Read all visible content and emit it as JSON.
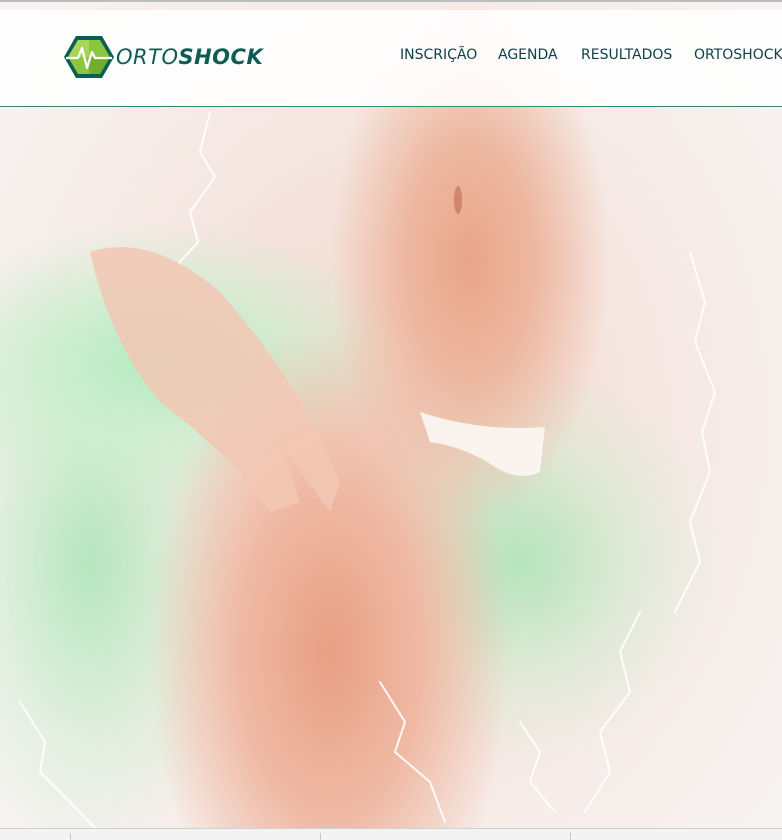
{
  "brand": {
    "name_light": "ORTO",
    "name_bold": "SHOCK",
    "colors": {
      "primary": "#0d5d55",
      "accent": "#8cc63f",
      "nav_text": "#0f3e49"
    }
  },
  "nav": {
    "items": [
      {
        "label": "INSCRIÇÃO"
      },
      {
        "label": "AGENDA"
      },
      {
        "label": "RESULTADOS"
      },
      {
        "label": "ORTOSHOCK®"
      }
    ]
  },
  "hero": {
    "image": "hero-photo"
  }
}
